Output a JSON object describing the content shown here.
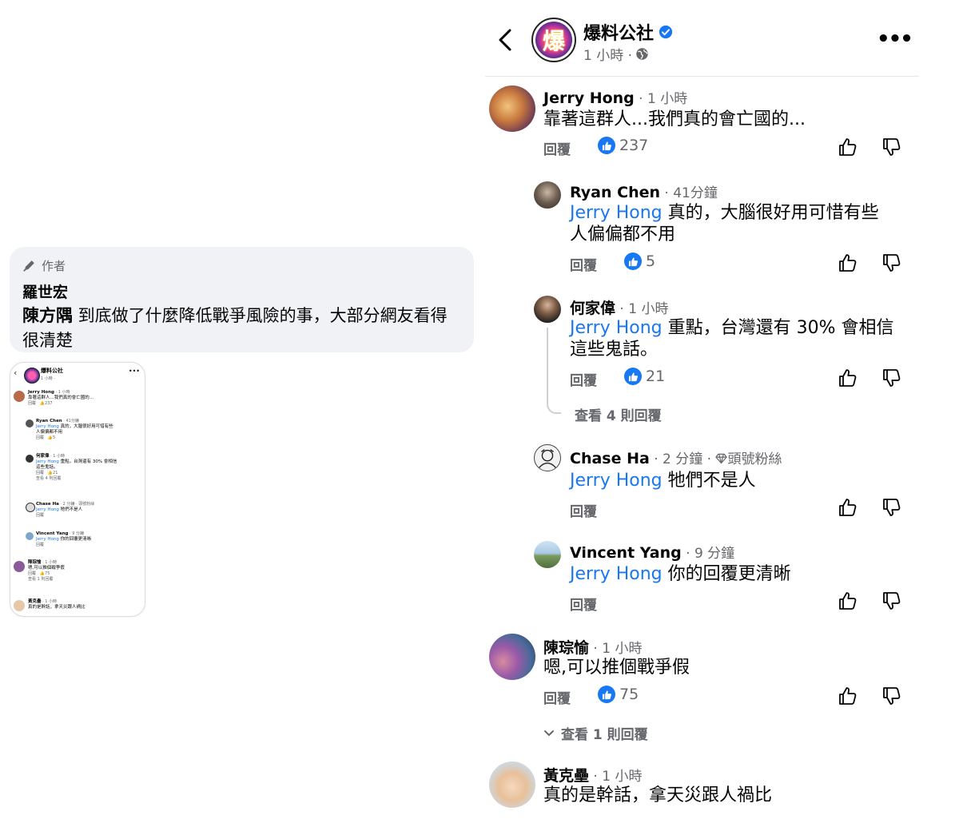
{
  "author_comment": {
    "tag": "作者",
    "name": "羅世宏",
    "mention": "陳方隅",
    "text": " 到底做了什麼降低戰爭風險的事，大部分網友看得很清楚"
  },
  "post": {
    "page_name": "爆料公社",
    "avatar_char": "爆",
    "time": "1 小時 ·",
    "more": "•••"
  },
  "labels": {
    "reply": "回覆"
  },
  "comments": [
    {
      "name": "Jerry Hong",
      "time": " · 1 小時",
      "text": "靠著這群人...我們真的會亡國的...",
      "likes": "237"
    },
    {
      "name": "Ryan Chen",
      "time": " · 41分鐘",
      "mention": "Jerry Hong",
      "text_line1": " 真的，大腦很好用可惜有些",
      "text_line2": "人偏偏都不用",
      "likes": "5"
    },
    {
      "name": "何家偉",
      "time": " · 1 小時",
      "mention": "Jerry Hong",
      "text_line1": " 重點，台灣還有 30% 會相信",
      "text_line2": "這些鬼話。",
      "likes": "21",
      "view_replies": "查看 4 則回覆"
    },
    {
      "name": "Chase Ha",
      "time": " · 2 分鐘 · ",
      "badge": "頭號粉絲",
      "mention": "Jerry Hong",
      "text": " 牠們不是人"
    },
    {
      "name": "Vincent Yang",
      "time": " · 9 分鐘",
      "mention": "Jerry Hong",
      "text": " 你的回覆更清晰"
    },
    {
      "name": "陳琮愉",
      "time": " · 1 小時",
      "text": "嗯,可以推個戰爭假",
      "likes": "75",
      "view_replies": "查看 1 則回覆"
    },
    {
      "name": "黃克壘",
      "time": " · 1 小時",
      "text": "真的是幹話，拿天災跟人禍比"
    }
  ],
  "colors": {
    "link": "#1877f2",
    "meta": "#65676b",
    "bubble": "#f0f2f5",
    "like_badge": "#1877f2"
  },
  "icons": [
    "pen-icon",
    "back-chevron-icon",
    "verified-icon",
    "globe-icon",
    "more-icon",
    "like-icon",
    "dislike-icon",
    "chevron-down-icon",
    "diamond-icon"
  ]
}
